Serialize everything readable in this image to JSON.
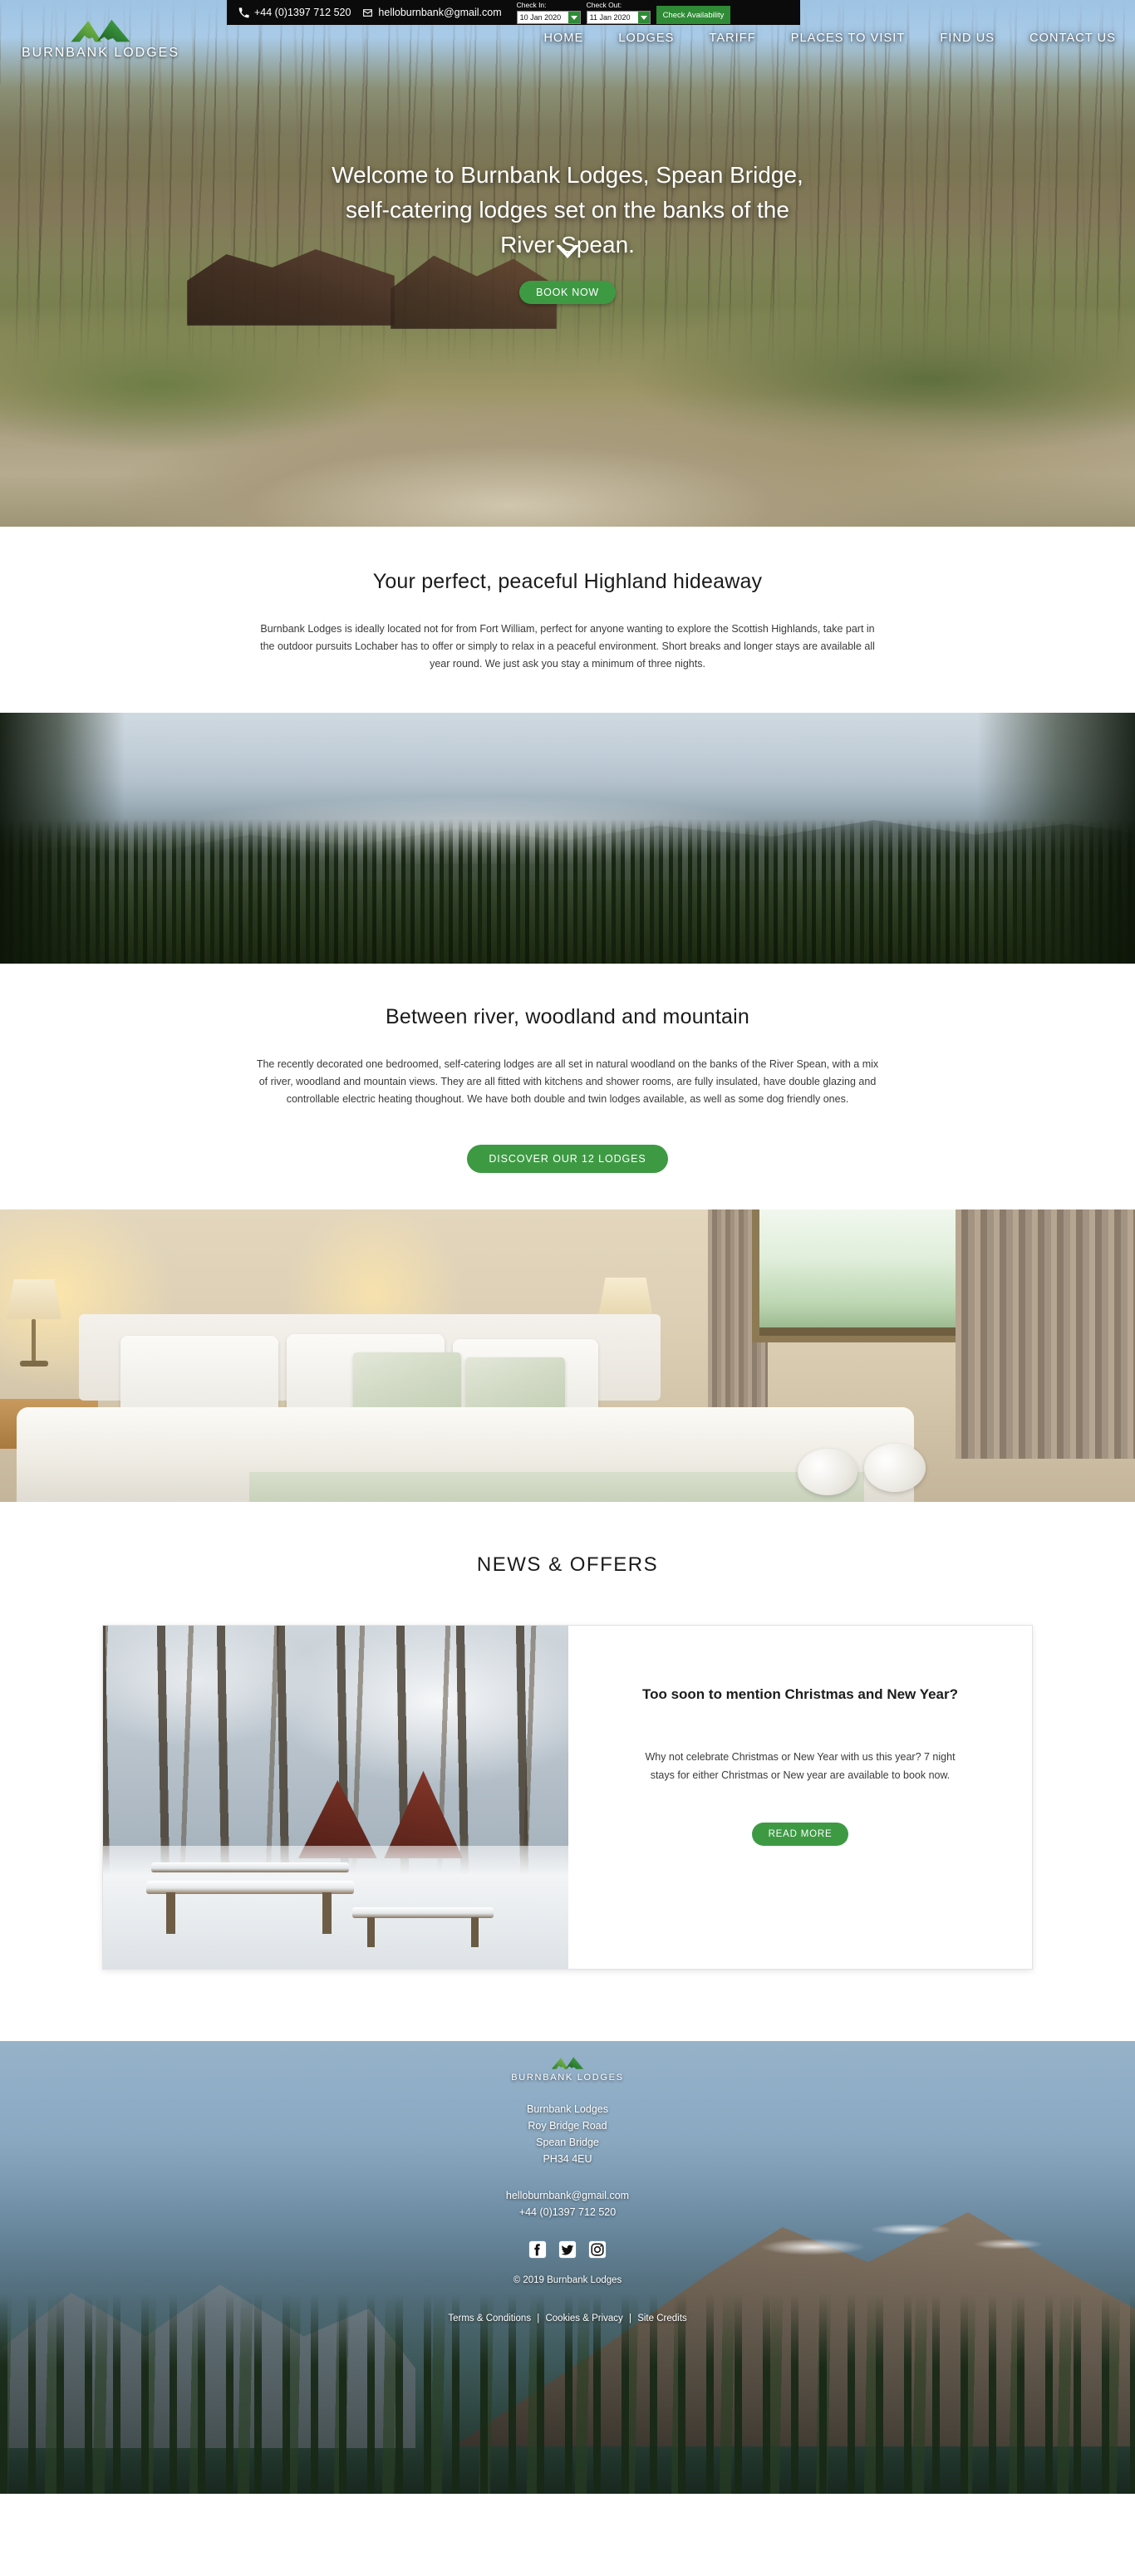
{
  "topbar": {
    "phone": "+44 (0)1397 712 520",
    "email": "helloburnbank@gmail.com",
    "phone_icon": "phone-icon",
    "email_icon": "envelope-icon",
    "checkin_label": "Check In:",
    "checkin_value": "10 Jan 2020",
    "checkout_label": "Check Out:",
    "checkout_value": "11 Jan 2020",
    "check_availability_label": "Check Availability"
  },
  "brand": {
    "name": "BURNBANK LODGES",
    "logo_icon": "mountain-logo-icon",
    "accent_green": "#3d9a43",
    "dark_green": "#2f8b36"
  },
  "nav": {
    "items": [
      {
        "label": "HOME"
      },
      {
        "label": "LODGES"
      },
      {
        "label": "TARIFF"
      },
      {
        "label": "PLACES TO VISIT"
      },
      {
        "label": "FIND US"
      },
      {
        "label": "CONTACT US"
      }
    ]
  },
  "hero": {
    "title_line1": "Welcome to Burnbank Lodges, Spean Bridge,",
    "title_line2": "self-catering lodges set on the banks of the",
    "title_line3": "River Spean.",
    "cta_label": "BOOK NOW",
    "scroll_icon": "chevron-down-icon"
  },
  "section_hideaway": {
    "title": "Your perfect, peaceful Highland hideaway",
    "body": "Burnbank Lodges is ideally located not for from Fort William, perfect for anyone wanting to explore the Scottish Highlands, take part in the outdoor pursuits Lochaber has to offer or simply to relax in a peaceful environment. Short breaks and longer stays are available all year round. We just ask you stay a minimum of three nights."
  },
  "section_between": {
    "title": "Between river, woodland and mountain",
    "body": "The recently decorated one bedroomed, self-catering lodges are all set in natural woodland on the banks of the River Spean, with a mix of river, woodland and mountain views. They are all fitted with kitchens and shower rooms, are fully insulated, have double glazing and controllable electric heating thoughout. We have both double and twin lodges available, as well as some dog friendly ones.",
    "cta_label": "DISCOVER OUR 12 LODGES"
  },
  "news": {
    "title": "NEWS & OFFERS",
    "card": {
      "heading": "Too soon to mention Christmas and New Year?",
      "text": "Why not celebrate Christmas or New Year with us this year?  7 night stays for either Christmas or New year are available to book now.",
      "cta_label": "READ MORE",
      "image_alt": "snowy-lodge-photo"
    }
  },
  "footer": {
    "brand_name": "BURNBANK LODGES",
    "address_line1": "Burnbank Lodges",
    "address_line2": "Roy Bridge Road",
    "address_line3": "Spean Bridge",
    "address_line4": "PH34 4EU",
    "email": "helloburnbank@gmail.com",
    "phone": "+44 (0)1397 712 520",
    "copyright": "© 2019 Burnbank Lodges",
    "social": [
      {
        "name": "facebook-icon"
      },
      {
        "name": "twitter-icon"
      },
      {
        "name": "instagram-icon"
      }
    ],
    "links": {
      "terms": "Terms & Conditions",
      "cookies": "Cookies & Privacy",
      "credits": "Site Credits",
      "separator": "|"
    }
  }
}
